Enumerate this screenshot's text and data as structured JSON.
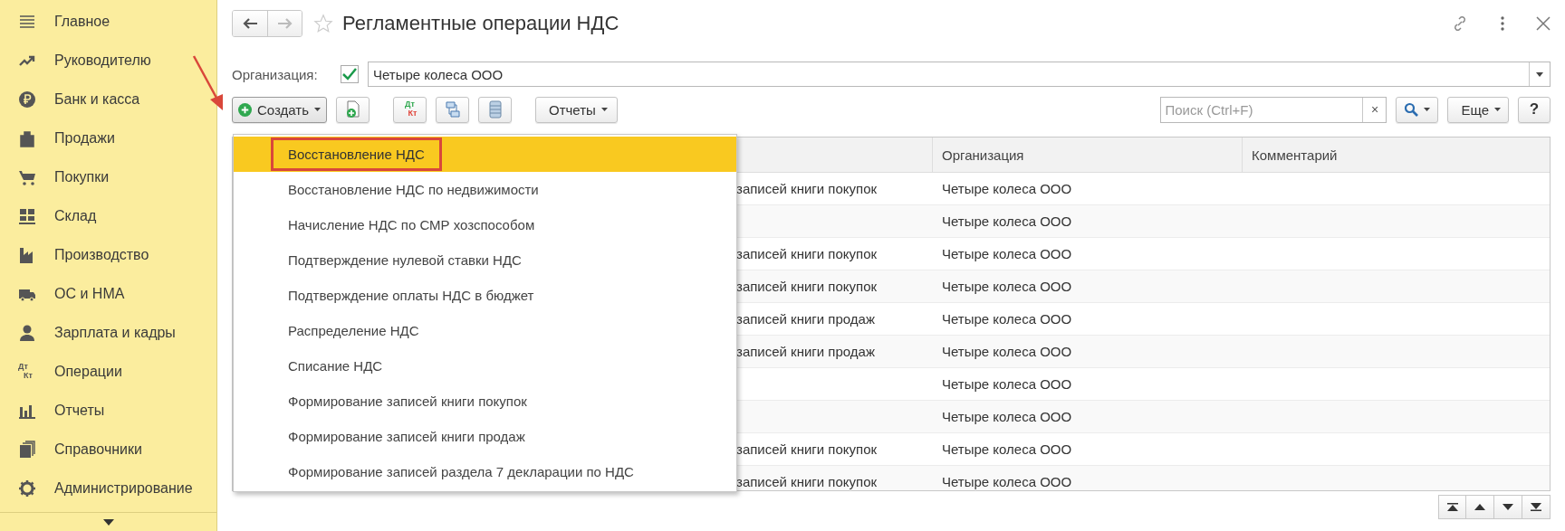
{
  "sidebar": {
    "items": [
      {
        "label": "Главное"
      },
      {
        "label": "Руководителю"
      },
      {
        "label": "Банк и касса"
      },
      {
        "label": "Продажи"
      },
      {
        "label": "Покупки"
      },
      {
        "label": "Склад"
      },
      {
        "label": "Производство"
      },
      {
        "label": "ОС и НМА"
      },
      {
        "label": "Зарплата и кадры"
      },
      {
        "label": "Операции",
        "icon_text": [
          "Дт",
          "Кт"
        ]
      },
      {
        "label": "Отчеты"
      },
      {
        "label": "Справочники"
      },
      {
        "label": "Администрирование"
      }
    ]
  },
  "window": {
    "title": "Регламентные операции НДС"
  },
  "filter": {
    "label": "Организация:",
    "checked": true,
    "value": "Четыре колеса ООО"
  },
  "toolbar": {
    "create": "Создать",
    "dt_kt": [
      "Дт",
      "Кт"
    ],
    "reports": "Отчеты",
    "search": {
      "placeholder": "Поиск (Ctrl+F)",
      "clear": "×"
    },
    "more": "Еще",
    "help": "?"
  },
  "menu": {
    "items": [
      {
        "label": "Восстановление НДС",
        "selected": true,
        "outlined": true
      },
      {
        "label": "Восстановление НДС по недвижимости",
        "selected": false,
        "outlined": false
      },
      {
        "label": "Начисление НДС по СМР хозспособом",
        "selected": false,
        "outlined": false
      },
      {
        "label": "Подтверждение нулевой ставки НДС",
        "selected": false,
        "outlined": false
      },
      {
        "label": "Подтверждение оплаты НДС в бюджет",
        "selected": false,
        "outlined": false
      },
      {
        "label": "Распределение НДС",
        "selected": false,
        "outlined": false
      },
      {
        "label": "Списание НДС",
        "selected": false,
        "outlined": false
      },
      {
        "label": "Формирование записей книги покупок",
        "selected": false,
        "outlined": false
      },
      {
        "label": "Формирование записей книги продаж",
        "selected": false,
        "outlined": false
      },
      {
        "label": "Формирование записей раздела 7 декларации по НДС",
        "selected": false,
        "outlined": false
      }
    ]
  },
  "table": {
    "columns": [
      "Организация",
      "Комментарий"
    ],
    "rows": [
      {
        "column_1": "записей книги покупок",
        "organization": "Четыре колеса ООО"
      },
      {
        "organization": "Четыре колеса ООО"
      },
      {
        "column_1": "записей книги покупок",
        "organization": "Четыре колеса ООО"
      },
      {
        "column_1": "записей книги покупок",
        "organization": "Четыре колеса ООО"
      },
      {
        "column_1": "записей книги продаж",
        "organization": "Четыре колеса ООО"
      },
      {
        "column_1": "записей книги продаж",
        "organization": "Четыре колеса ООО"
      },
      {
        "organization": "Четыре колеса ООО"
      },
      {
        "organization": "Четыре колеса ООО"
      },
      {
        "column_1": "записей книги покупок",
        "organization": "Четыре колеса ООО"
      },
      {
        "column_1": "записей книги покупок",
        "organization": "Четыре колеса ООО"
      }
    ]
  }
}
